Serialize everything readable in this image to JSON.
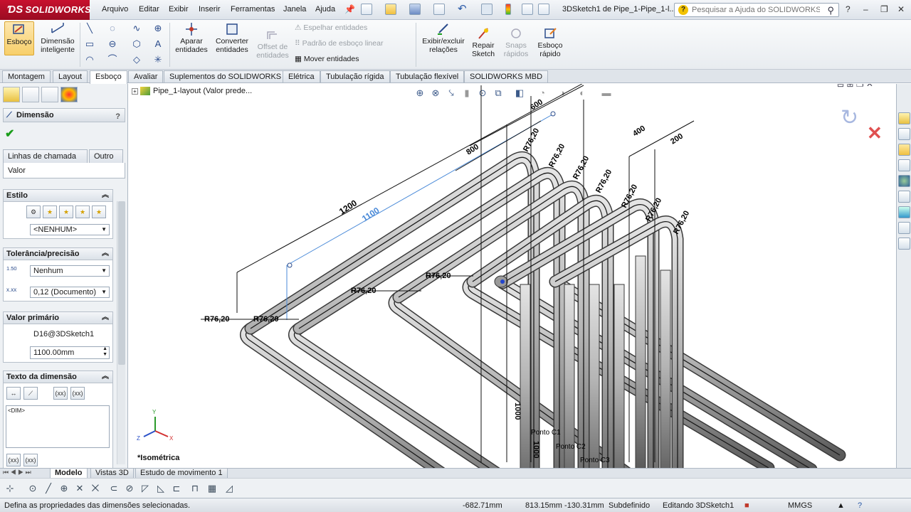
{
  "app": {
    "brand": "SOLIDWORKS",
    "window_title": "3DSketch1 de Pipe_1-Pipe_1-l...",
    "menus": [
      "Arquivo",
      "Editar",
      "Exibir",
      "Inserir",
      "Ferramentas",
      "Janela",
      "Ajuda"
    ],
    "help_search_placeholder": "Pesquisar a Ajuda do SOLIDWORKS"
  },
  "ribbon": {
    "sketch": "Esboço",
    "smart_dimension_1": "Dimensão",
    "smart_dimension_2": "inteligente",
    "trim_1": "Aparar",
    "trim_2": "entidades",
    "convert_1": "Converter",
    "convert_2": "entidades",
    "offset_1": "Offset de",
    "offset_2": "entidades",
    "mirror": "Espelhar entidades",
    "linear_pattern": "Padrão de esboço linear",
    "move": "Mover entidades",
    "relations_1": "Exibir/excluir",
    "relations_2": "relações",
    "repair_1": "Repair",
    "repair_2": "Sketch",
    "snaps_1": "Snaps",
    "snaps_2": "rápidos",
    "rapid_1": "Esboço",
    "rapid_2": "rápido"
  },
  "tabs": [
    "Montagem",
    "Layout",
    "Esboço",
    "Avaliar",
    "Suplementos do SOLIDWORKS",
    "Elétrica",
    "Tubulação rígida",
    "Tubulação flexível",
    "SOLIDWORKS MBD"
  ],
  "property_manager": {
    "title": "Dimensão",
    "subtab_leaders": "Linhas de chamada",
    "subtab_other": "Outro",
    "subtab_value": "Valor",
    "style": {
      "heading": "Estilo",
      "selected": "<NENHUM>"
    },
    "tolerance": {
      "heading": "Tolerância/precisão",
      "tol_icon_top": "1.50",
      "tol_value": "Nenhum",
      "precision_value": "0,12 (Documento)"
    },
    "primary_value": {
      "heading": "Valor primário",
      "name": "D16@3DSketch1",
      "value": "1100.00mm"
    },
    "dim_text": {
      "heading": "Texto da dimensão",
      "text": "<DIM>",
      "b1": "(xx)",
      "b2": "(xx)",
      "b3": "(xx)",
      "b4": "(xx)"
    }
  },
  "graphics": {
    "tree_label": "Pipe_1-layout  (Valor prede...",
    "view_name": "*Isométrica",
    "dims": {
      "d1200": "1200",
      "d1100": "1100",
      "d800": "800",
      "d600": "600",
      "d400": "400",
      "d200": "200",
      "d1000a": "1000",
      "d1000b": "1000",
      "r": "R76,20"
    },
    "points": [
      "Ponto C1",
      "Ponto C2",
      "Ponto C3"
    ]
  },
  "bottom_tabs": [
    "Modelo",
    "Vistas 3D",
    "Estudo de movimento 1"
  ],
  "status": {
    "message": "Defina as propriedades das dimensões selecionadas.",
    "x": "-682.71mm",
    "yz": "813.15mm -130.31mm",
    "state": "Subdefinido",
    "editing": "Editando 3DSketch1",
    "units": "MMGS"
  }
}
